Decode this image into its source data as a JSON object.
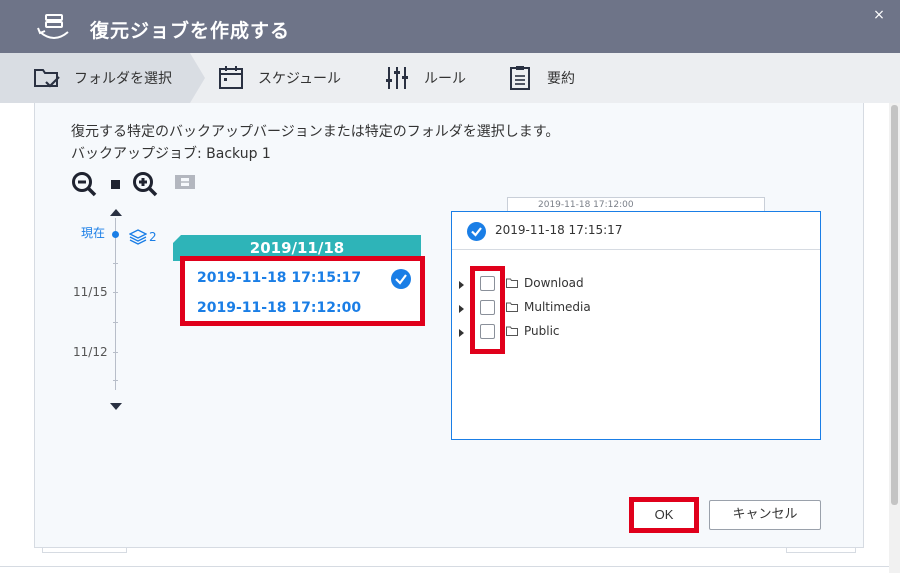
{
  "window": {
    "title": "復元ジョブを作成する",
    "close_label": "×"
  },
  "steps": [
    {
      "label": "フォルダを選択",
      "icon": "folder-check-icon",
      "active": true
    },
    {
      "label": "スケジュール",
      "icon": "calendar-icon",
      "active": false
    },
    {
      "label": "ルール",
      "icon": "sliders-icon",
      "active": false
    },
    {
      "label": "要約",
      "icon": "clipboard-icon",
      "active": false
    }
  ],
  "description": {
    "line1": "復元する特定のバックアップバージョンまたは特定のフォルダを選択します。",
    "line2": "バックアップジョブ:  Backup 1"
  },
  "timeline": {
    "now_label": "現在",
    "version_count": "2",
    "dates": [
      "11/15",
      "11/12"
    ]
  },
  "date_card": {
    "date": "2019/11/18",
    "versions": [
      "2019-11-18 17:15:17",
      "2019-11-18 17:12:00"
    ],
    "selected_index": 0
  },
  "back_card": {
    "text": "2019-11-18 17:12:00"
  },
  "folder_panel": {
    "title": "2019-11-18 17:15:17",
    "folders": [
      "Download",
      "Multimedia",
      "Public"
    ]
  },
  "buttons": {
    "ok": "OK",
    "cancel": "キャンセル"
  },
  "colors": {
    "titlebar": "#6e7488",
    "accent": "#1a7ee6",
    "teal": "#2eb4b8",
    "highlight": "#e0001b"
  }
}
